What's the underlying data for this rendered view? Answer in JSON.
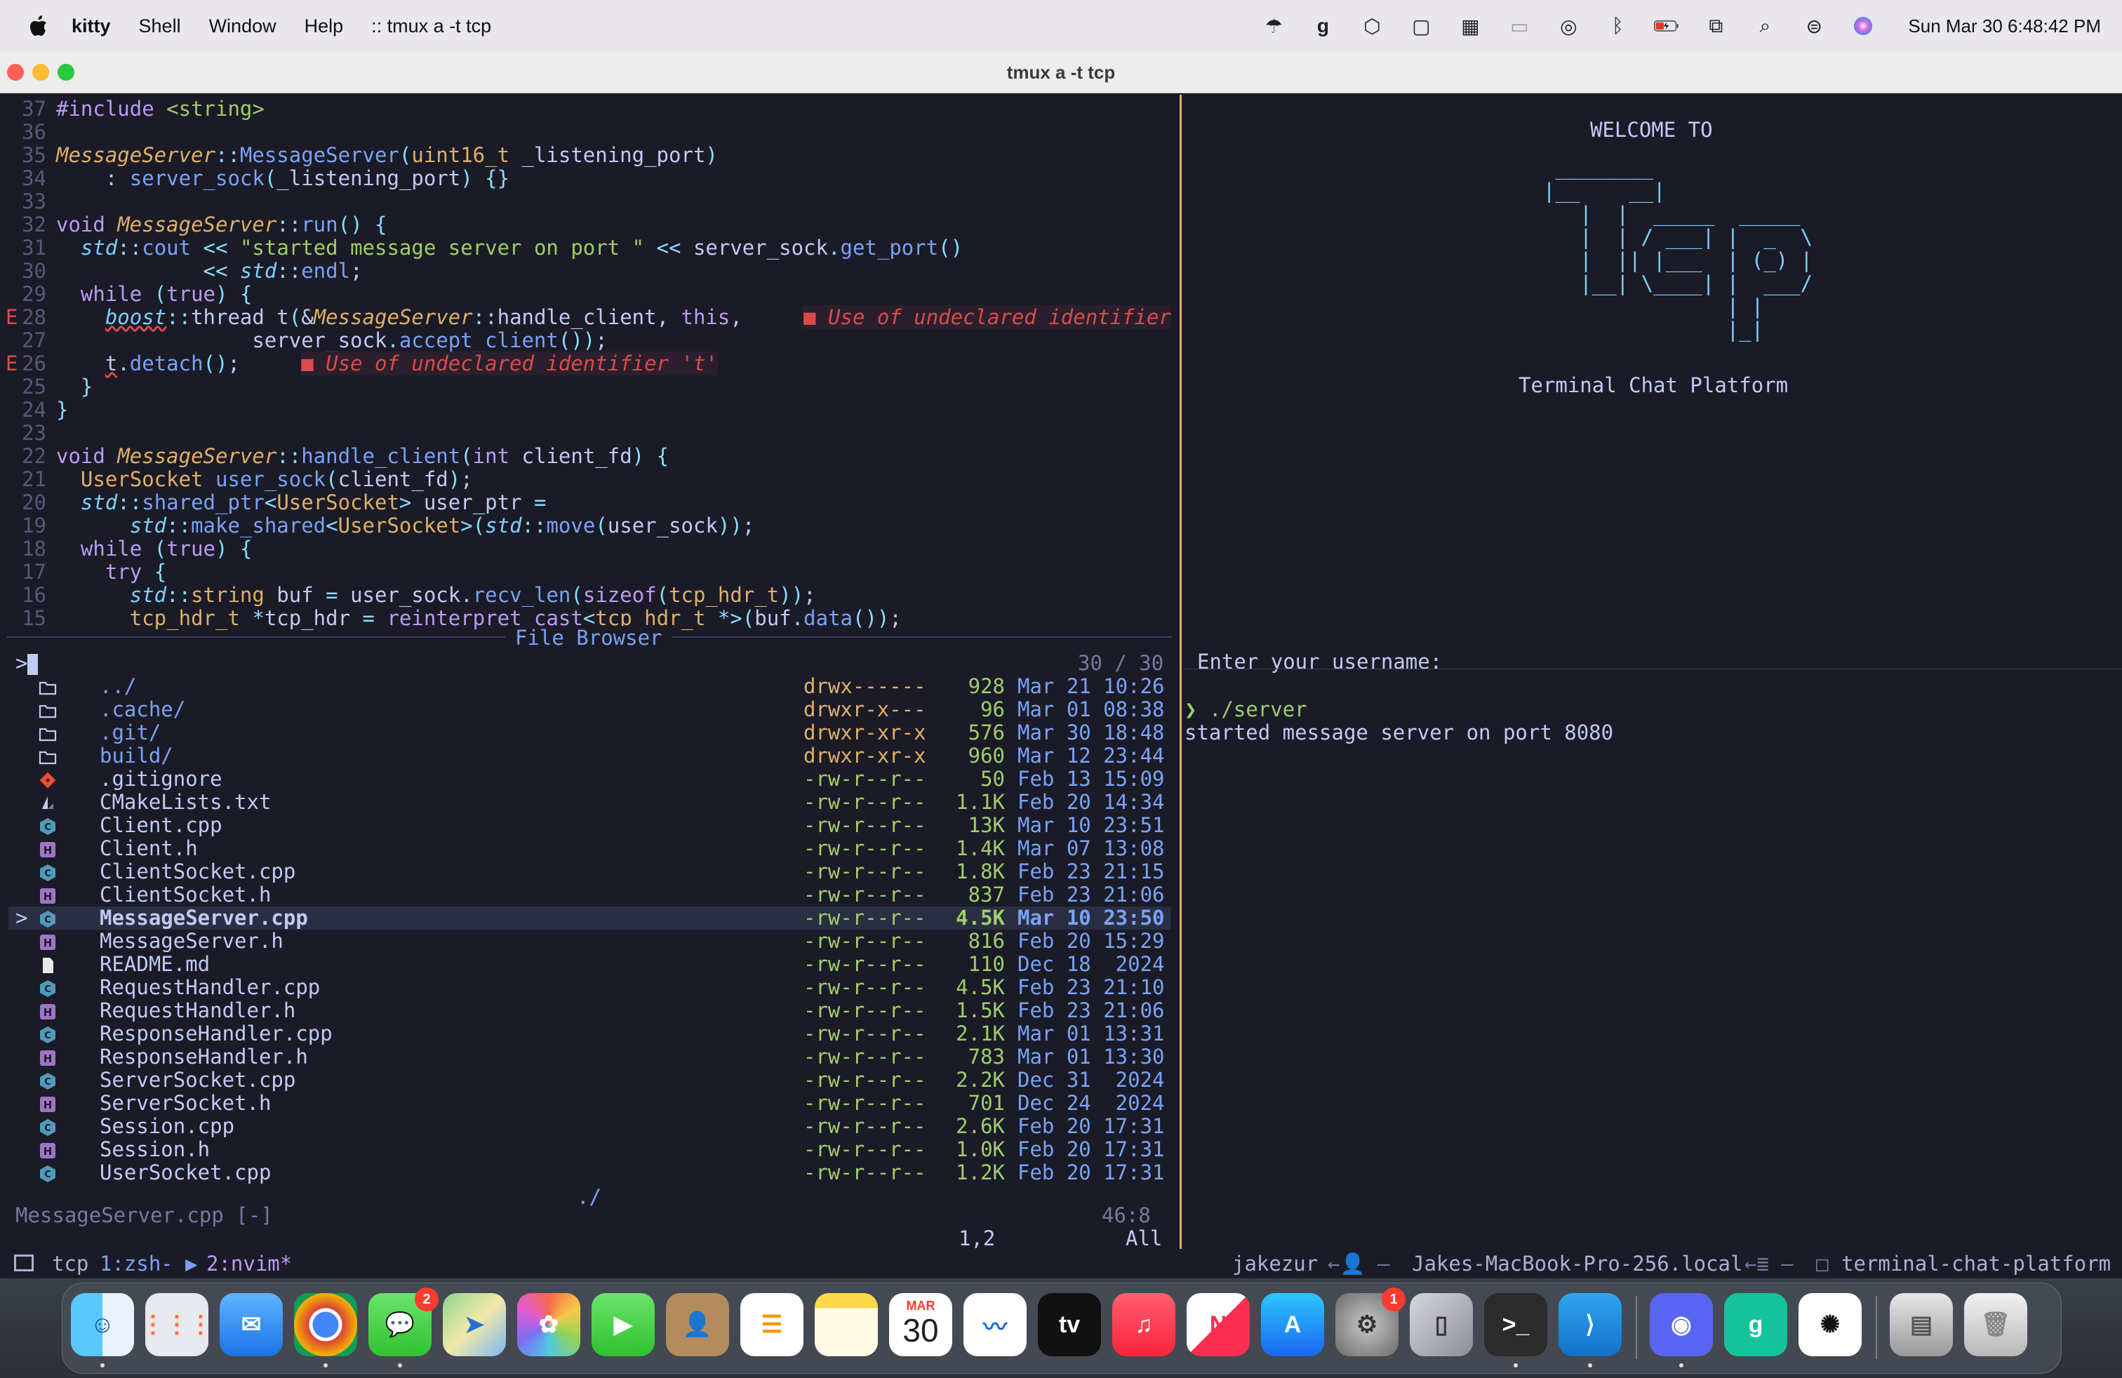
{
  "menubar": {
    "app_name": "kitty",
    "items": [
      "Shell",
      "Window",
      "Help",
      ":: tmux a -t tcp"
    ],
    "tray_icons": [
      "cloud-rain-icon",
      "grammarly-icon",
      "box-icon",
      "app-icon",
      "layout-icon",
      "window-icon",
      "airdrop-icon",
      "bluetooth-icon",
      "battery-charging-icon",
      "link-icon",
      "search-icon",
      "control-center-icon",
      "siri-icon"
    ],
    "clock": "Sun Mar 30  6:48:42 PM"
  },
  "window": {
    "title": "tmux a -t tcp"
  },
  "editor": {
    "lines": [
      {
        "n": "37",
        "html": "<span class='kw'>#include</span> <span class='str'>&lt;string&gt;</span>"
      },
      {
        "n": "36",
        "html": ""
      },
      {
        "n": "35",
        "html": "<span class='cls'>MessageServer</span><span class='op'>::</span><span class='fn'>MessageServer</span><span class='par'>(</span><span class='ty'>uint16_t</span> _listening_port<span class='par'>)</span>"
      },
      {
        "n": "34",
        "html": "    <span class='op'>:</span> <span class='fn'>server_sock</span><span class='par'>(</span>_listening_port<span class='par'>)</span> <span class='par'>{}</span>"
      },
      {
        "n": "33",
        "html": ""
      },
      {
        "n": "32",
        "html": "<span class='kw'>void</span> <span class='cls'>MessageServer</span><span class='op'>::</span><span class='fn'>run</span><span class='par'>()</span> <span class='par'>{</span>"
      },
      {
        "n": "31",
        "html": "  <span class='ns'>std</span><span class='op'>::</span><span class='fn'>cout</span> <span class='op'>&lt;&lt;</span> <span class='str'>\"started message server on port \"</span> <span class='op'>&lt;&lt;</span> server_sock<span class='op'>.</span><span class='fn'>get_port</span><span class='par'>()</span>"
      },
      {
        "n": "30",
        "html": "            <span class='op'>&lt;&lt;</span> <span class='ns'>std</span><span class='op'>::</span><span class='fn'>endl</span>;"
      },
      {
        "n": "29",
        "html": "  <span class='kw'>while</span> <span class='par'>(</span><span class='kw'>true</span><span class='par'>)</span> <span class='par'>{</span>"
      },
      {
        "n": "28",
        "sign": "E",
        "html": "    <span class='ns err-u'>boost</span><span class='op'>::</span>thread t<span class='par'>(</span>&amp;<span class='cls'>MessageServer</span><span class='op'>::</span>handle_client, <span class='kw'>this</span>,     <span class='err'>■ Use of undeclared identifier</span>"
      },
      {
        "n": "27",
        "html": "                server_sock<span class='op'>.</span><span class='fn'>accept_client</span><span class='par'>())</span>;"
      },
      {
        "n": "26",
        "sign": "E",
        "html": "    <span class='err-u'>t</span><span class='op'>.</span><span class='fn'>detach</span><span class='par'>()</span>;     <span class='err'>■ Use of undeclared identifier 't'</span>"
      },
      {
        "n": "25",
        "html": "  <span class='par'>}</span>"
      },
      {
        "n": "24",
        "html": "<span class='par'>}</span>"
      },
      {
        "n": "23",
        "html": ""
      },
      {
        "n": "22",
        "html": "<span class='kw'>void</span> <span class='cls'>MessageServer</span><span class='op'>::</span><span class='fn'>handle_client</span><span class='par'>(</span><span class='kw'>int</span> client_fd<span class='par'>)</span> <span class='par'>{</span>"
      },
      {
        "n": "21",
        "html": "  <span class='ty'>UserSocket</span> <span class='fn'>user_sock</span><span class='par'>(</span>client_fd<span class='par'>)</span>;"
      },
      {
        "n": "20",
        "html": "  <span class='ns'>std</span><span class='op'>::</span><span class='fn'>shared_ptr</span><span class='op'>&lt;</span><span class='ty'>UserSocket</span><span class='op'>&gt;</span> user_ptr <span class='op'>=</span>"
      },
      {
        "n": "19",
        "html": "      <span class='ns'>std</span><span class='op'>::</span><span class='fn'>make_shared</span><span class='op'>&lt;</span><span class='ty'>UserSocket</span><span class='op'>&gt;</span><span class='par'>(</span><span class='ns'>std</span><span class='op'>::</span><span class='fn'>move</span><span class='par'>(</span>user_sock<span class='par'>))</span>;"
      },
      {
        "n": "18",
        "html": "  <span class='kw'>while</span> <span class='par'>(</span><span class='kw'>true</span><span class='par'>)</span> <span class='par'>{</span>"
      },
      {
        "n": "17",
        "html": "    <span class='kw'>try</span> <span class='par'>{</span>"
      },
      {
        "n": "16",
        "html": "      <span class='ns'>std</span><span class='op'>::</span><span class='ty'>string</span> buf <span class='op'>=</span> user_sock<span class='op'>.</span><span class='fn'>recv_len</span><span class='par'>(</span><span class='kw'>sizeof</span><span class='par'>(</span><span class='ty'>tcp_hdr_t</span><span class='par'>))</span>;"
      },
      {
        "n": "15",
        "html": "      <span class='ty'>tcp_hdr_t</span> <span class='op'>*</span>tcp_hdr <span class='op'>=</span> <span class='kw'>reinterpret_cast</span><span class='op'>&lt;</span><span class='ty'>tcp_hdr_t</span> <span class='op'>*&gt;</span><span class='par'>(</span>buf<span class='op'>.</span><span class='fn'>data</span><span class='par'>())</span>;"
      }
    ]
  },
  "file_browser": {
    "title": "File Browser",
    "prompt": ">",
    "count": "30 / 30",
    "files": [
      {
        "name": "../",
        "icon": "folder-icon",
        "perm": "drwx------",
        "size": "928",
        "date": "Mar 21 10:26",
        "dir": true
      },
      {
        "name": ".cache/",
        "icon": "folder-icon",
        "perm": "drwxr-x---",
        "size": "96",
        "date": "Mar 01 08:38",
        "dir": true
      },
      {
        "name": ".git/",
        "icon": "folder-icon",
        "perm": "drwxr-xr-x",
        "size": "576",
        "date": "Mar 30 18:48",
        "dir": true
      },
      {
        "name": "build/",
        "icon": "folder-icon",
        "perm": "drwxr-xr-x",
        "size": "960",
        "date": "Mar 12 23:44",
        "dir": true
      },
      {
        "name": ".gitignore",
        "icon": "git-icon",
        "perm": "-rw-r--r--",
        "size": "50",
        "date": "Feb 13 15:09"
      },
      {
        "name": "CMakeLists.txt",
        "icon": "cmake-icon",
        "perm": "-rw-r--r--",
        "size": "1.1K",
        "date": "Feb 20 14:34"
      },
      {
        "name": "Client.cpp",
        "icon": "cpp-icon",
        "perm": "-rw-r--r--",
        "size": "13K",
        "date": "Mar 10 23:51"
      },
      {
        "name": "Client.h",
        "icon": "header-icon",
        "perm": "-rw-r--r--",
        "size": "1.4K",
        "date": "Mar 07 13:08"
      },
      {
        "name": "ClientSocket.cpp",
        "icon": "cpp-icon",
        "perm": "-rw-r--r--",
        "size": "1.8K",
        "date": "Feb 23 21:15"
      },
      {
        "name": "ClientSocket.h",
        "icon": "header-icon",
        "perm": "-rw-r--r--",
        "size": "837",
        "date": "Feb 23 21:06"
      },
      {
        "name": "MessageServer.cpp",
        "icon": "cpp-icon",
        "perm": "-rw-r--r--",
        "size": "4.5K",
        "date": "Mar 10 23:50",
        "selected": true
      },
      {
        "name": "MessageServer.h",
        "icon": "header-icon",
        "perm": "-rw-r--r--",
        "size": "816",
        "date": "Feb 20 15:29"
      },
      {
        "name": "README.md",
        "icon": "markdown-icon",
        "perm": "-rw-r--r--",
        "size": "110",
        "date": "Dec 18  2024"
      },
      {
        "name": "RequestHandler.cpp",
        "icon": "cpp-icon",
        "perm": "-rw-r--r--",
        "size": "4.5K",
        "date": "Feb 23 21:10"
      },
      {
        "name": "RequestHandler.h",
        "icon": "header-icon",
        "perm": "-rw-r--r--",
        "size": "1.5K",
        "date": "Feb 23 21:06"
      },
      {
        "name": "ResponseHandler.cpp",
        "icon": "cpp-icon",
        "perm": "-rw-r--r--",
        "size": "2.1K",
        "date": "Mar 01 13:31"
      },
      {
        "name": "ResponseHandler.h",
        "icon": "header-icon",
        "perm": "-rw-r--r--",
        "size": "783",
        "date": "Mar 01 13:30"
      },
      {
        "name": "ServerSocket.cpp",
        "icon": "cpp-icon",
        "perm": "-rw-r--r--",
        "size": "2.2K",
        "date": "Dec 31  2024"
      },
      {
        "name": "ServerSocket.h",
        "icon": "header-icon",
        "perm": "-rw-r--r--",
        "size": "701",
        "date": "Dec 24  2024"
      },
      {
        "name": "Session.cpp",
        "icon": "cpp-icon",
        "perm": "-rw-r--r--",
        "size": "2.6K",
        "date": "Feb 20 17:31"
      },
      {
        "name": "Session.h",
        "icon": "header-icon",
        "perm": "-rw-r--r--",
        "size": "1.0K",
        "date": "Feb 20 17:31"
      },
      {
        "name": "UserSocket.cpp",
        "icon": "cpp-icon",
        "perm": "-rw-r--r--",
        "size": "1.2K",
        "date": "Feb 20 17:31"
      }
    ],
    "cwd": "./"
  },
  "nvim_status": {
    "filename": "MessageServer.cpp [-]",
    "position": "46:8",
    "ruler": "1,2",
    "scroll": "All"
  },
  "right_pane": {
    "welcome": "WELCOME TO",
    "ascii": [
      "   ________",
      "  |__    __|",
      "     |  |  _____  _____",
      "     |  | / ___| |  _  \\",
      "     |  || |___  | (_) |",
      "     |__| \\____| |  ___/",
      "                 | |",
      "                 |_|"
    ],
    "subtitle": "Terminal Chat Platform",
    "username_prompt": "Enter your username:",
    "shell_prompt": "❯",
    "command": "./server",
    "output": "started message server on port 8080"
  },
  "tmux": {
    "session": "tcp",
    "win1": "1:zsh-",
    "win2": "2:nvim*",
    "user": "jakezur",
    "host": "Jakes-MacBook-Pro-256.local",
    "dir": "terminal-chat-platform"
  },
  "dock": {
    "apps": [
      "Finder",
      "Launchpad",
      "Mail",
      "Chrome",
      "Messages",
      "Maps",
      "Photos",
      "FaceTime",
      "Contacts",
      "Reminders",
      "Notes",
      "Calendar",
      "Freeform",
      "Apple TV",
      "Music",
      "News",
      "App Store",
      "System Settings",
      "iPhone Mirroring",
      "Terminal",
      "VS Code",
      "Discord",
      "Grammarly",
      "ChatGPT",
      "Downloads",
      "Trash"
    ],
    "calendar_month": "MAR",
    "calendar_day": "30",
    "messages_badge": "2",
    "settings_badge": "1"
  },
  "colors": {
    "background": "#1a1b26",
    "error": "#db4b4b",
    "pane_divider": "#e0af68"
  }
}
